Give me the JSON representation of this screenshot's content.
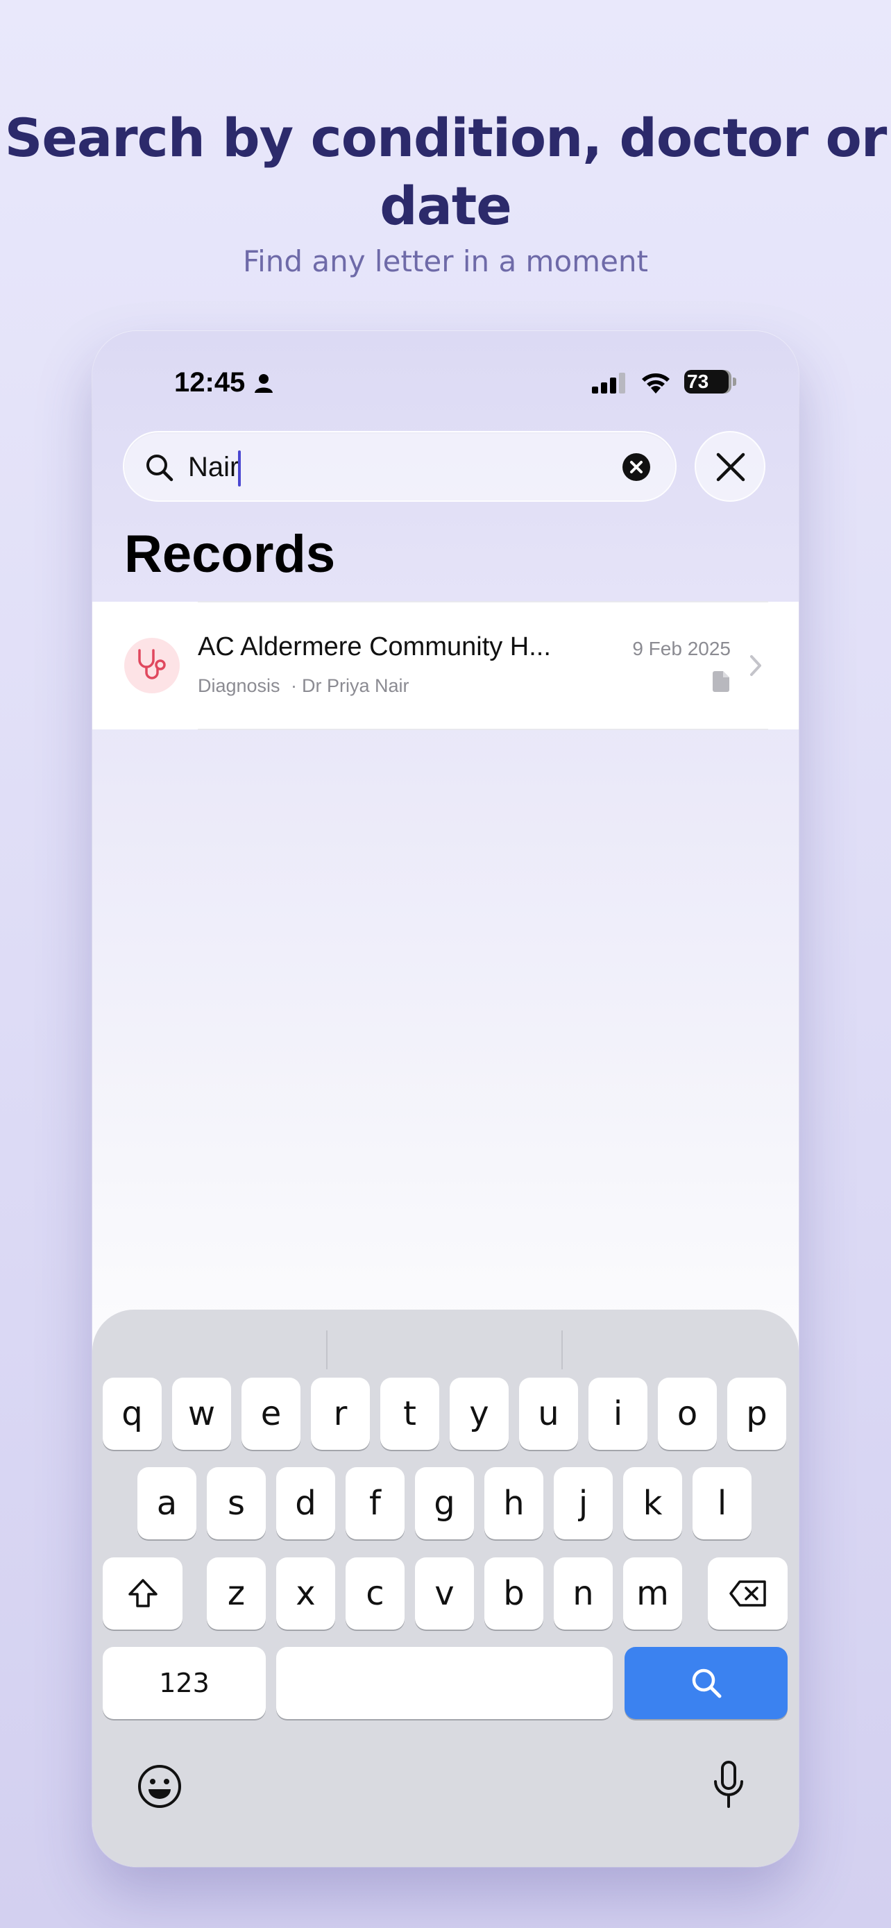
{
  "promo": {
    "headline": "Search by condition, doctor or date",
    "subline": "Find any letter in a moment"
  },
  "status_bar": {
    "time": "12:45",
    "battery": "73"
  },
  "search": {
    "value": "Nair",
    "placeholder": ""
  },
  "section": {
    "title": "Records"
  },
  "records": [
    {
      "title": "AC Aldermere Community H...",
      "type": "Diagnosis",
      "doctor": "Dr Priya Nair",
      "date": "9 Feb 2025",
      "icon": "stethoscope-icon"
    }
  ],
  "keyboard": {
    "row1": [
      "q",
      "w",
      "e",
      "r",
      "t",
      "y",
      "u",
      "i",
      "o",
      "p"
    ],
    "row2": [
      "a",
      "s",
      "d",
      "f",
      "g",
      "h",
      "j",
      "k",
      "l"
    ],
    "row3": [
      "z",
      "x",
      "c",
      "v",
      "b",
      "n",
      "m"
    ],
    "numbers_label": "123",
    "accent_color": "#3b82f0"
  },
  "colors": {
    "headline": "#2c2a6b",
    "subline": "#6e6aa8",
    "avatar_bg": "#fde3e6",
    "stethoscope": "#e0485e"
  }
}
